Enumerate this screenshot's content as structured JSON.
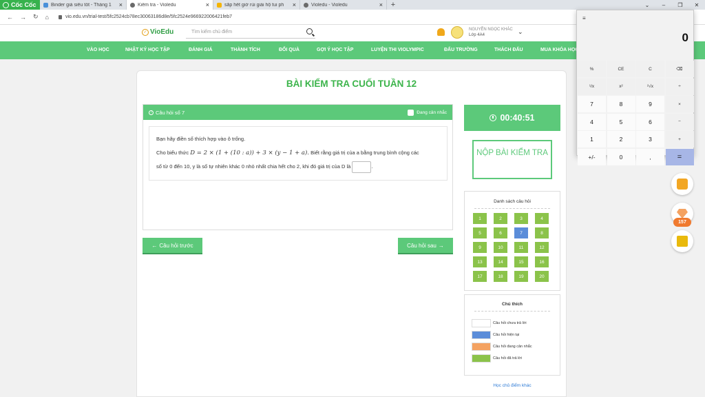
{
  "browser": {
    "brand": "Cốc Cốc",
    "tabs": [
      {
        "title": "Binder giá siêu tốt - Tháng 1",
        "icon": "binder-tab-icon"
      },
      {
        "title": "Kiểm tra - Violedu",
        "icon": "violedu-tab-icon",
        "active": true
      },
      {
        "title": "sắp hết giờ rùi giải hộ tui ph",
        "icon": "hoidap-tab-icon"
      },
      {
        "title": "Violedu - Violedu",
        "icon": "violedu-tab-icon"
      }
    ],
    "url": "vio.edu.vn/trial-test/5fc2524cb78ec30063186d8e/5fc2524e966922006421feb7"
  },
  "header": {
    "logo": "VioEdu",
    "search_placeholder": "Tìm kiếm chủ điểm",
    "user_name": "NGUYỄN NGỌC KHÁC",
    "user_class": "Lớp 4A4"
  },
  "nav": [
    "VÀO HỌC",
    "NHẬT KÝ HỌC TẬP",
    "ĐÁNH GIÁ",
    "THÀNH TÍCH",
    "ĐỔI QUÀ",
    "GỢI Ý HỌC TẬP",
    "LUYỆN THI VIOLYMPIC",
    "ĐẤU TRƯỜNG",
    "THÁCH ĐẤU",
    "MUA KHÓA HỌC"
  ],
  "quiz": {
    "title": "BÀI KIỂM TRA CUỐI TUẦN 12",
    "question_label": "Câu hỏi số 7",
    "flag_label": "Đang cân nhắc",
    "instruction": "Bạn hãy điền số thích hợp vào ô trống.",
    "line1_prefix": "Cho biểu thức",
    "formula": "D = 2 × (1 + (10 : a)) + 3 × (y − 1 + a).",
    "line1_suffix": "Biết rằng giá trị của a bằng trung bình cộng các",
    "line2": "số từ 0 đến 10, y là số tự nhiên khác 0 nhỏ nhất chia hết cho 2, khi đó giá trị của D là",
    "prev_label": "Câu hỏi trước",
    "next_label": "Câu hỏi sau"
  },
  "side": {
    "timer": "00:40:51",
    "submit_label": "NỘP BÀI KIỂM TRA",
    "question_list_title": "Danh sách câu hỏi",
    "questions": [
      "1",
      "2",
      "3",
      "4",
      "5",
      "6",
      "7",
      "8",
      "9",
      "10",
      "11",
      "12",
      "13",
      "14",
      "15",
      "16",
      "17",
      "18",
      "19",
      "20"
    ],
    "current_question": 7,
    "legend_title": "Chú thích",
    "legend": [
      {
        "label": "Câu hỏi chưa trả lời",
        "color": "#ffffff"
      },
      {
        "label": "Câu hỏi hiện tại",
        "color": "#5b8dd9"
      },
      {
        "label": "Câu hỏi đang cân nhắc",
        "color": "#f4a261"
      },
      {
        "label": "Câu hỏi đã trả lời",
        "color": "#8bc34a"
      }
    ],
    "other_user_link": "Học chủ điểm khác",
    "gem_count": "157"
  },
  "calculator": {
    "display": "0",
    "keys": [
      "%",
      "CE",
      "C",
      "⌫",
      "¹/x",
      "x²",
      "²√x",
      "÷",
      "7",
      "8",
      "9",
      "×",
      "4",
      "5",
      "6",
      "−",
      "1",
      "2",
      "3",
      "+",
      "+/-",
      "0",
      ",",
      "="
    ]
  },
  "colors": {
    "accent": "#5cc97a",
    "current": "#5b8dd9",
    "answered": "#8bc34a"
  }
}
